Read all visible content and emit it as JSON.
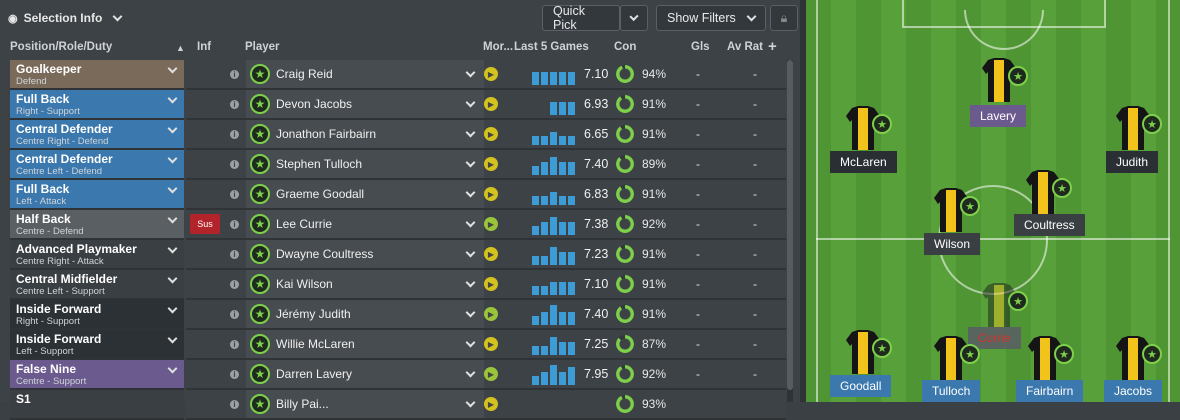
{
  "toolbar": {
    "selection_label": "Selection Info",
    "quick_pick": "Quick Pick",
    "show_filters": "Show Filters"
  },
  "headers": {
    "position": "Position/Role/Duty",
    "inf": "Inf",
    "player": "Player",
    "morale": "Mor...",
    "last5": "Last 5 Games",
    "con": "Con",
    "gls": "Gls",
    "avrat": "Av Rat"
  },
  "roles": [
    {
      "name": "Goalkeeper",
      "duty": "Defend",
      "color": "#7a6a5a"
    },
    {
      "name": "Full Back",
      "duty": "Right - Support",
      "color": "#3a78ad"
    },
    {
      "name": "Central Defender",
      "duty": "Centre Right - Defend",
      "color": "#3a78ad"
    },
    {
      "name": "Central Defender",
      "duty": "Centre Left - Defend",
      "color": "#3a78ad"
    },
    {
      "name": "Full Back",
      "duty": "Left - Attack",
      "color": "#3a78ad"
    },
    {
      "name": "Half Back",
      "duty": "Centre - Defend",
      "color": "#5a5f63"
    },
    {
      "name": "Advanced Playmaker",
      "duty": "Centre Right - Attack",
      "color": "#3a3f43"
    },
    {
      "name": "Central Midfielder",
      "duty": "Centre Left - Support",
      "color": "#3a3f43"
    },
    {
      "name": "Inside Forward",
      "duty": "Right - Support",
      "color": "#2c3135"
    },
    {
      "name": "Inside Forward",
      "duty": "Left - Support",
      "color": "#2c3135"
    },
    {
      "name": "False Nine",
      "duty": "Centre - Support",
      "color": "#6a5a8e"
    },
    {
      "name": "S1",
      "duty": "",
      "color": "#3a3f43"
    }
  ],
  "players": [
    {
      "name": "Craig Reid",
      "rating": "7.10",
      "con": "94%",
      "gls": "-",
      "avrat": "-",
      "morale": "#d4c21e",
      "form": [
        0.6,
        0.6,
        0.6,
        0.6,
        0.6
      ]
    },
    {
      "name": "Devon Jacobs",
      "rating": "6.93",
      "con": "91%",
      "gls": "-",
      "avrat": "-",
      "morale": "#d4c21e",
      "form": [
        0,
        0,
        0.6,
        0.6,
        0.6
      ]
    },
    {
      "name": "Jonathon Fairbairn",
      "rating": "6.65",
      "con": "91%",
      "gls": "-",
      "avrat": "-",
      "morale": "#d4c21e",
      "form": [
        0.4,
        0.4,
        0.6,
        0.4,
        0.4
      ]
    },
    {
      "name": "Stephen Tulloch",
      "rating": "7.40",
      "con": "89%",
      "gls": "-",
      "avrat": "-",
      "morale": "#d4c21e",
      "form": [
        0.4,
        0.6,
        0.8,
        0.6,
        0.6
      ]
    },
    {
      "name": "Graeme Goodall",
      "rating": "6.83",
      "con": "91%",
      "gls": "-",
      "avrat": "-",
      "morale": "#d4c21e",
      "form": [
        0.4,
        0.4,
        0.6,
        0.4,
        0.4
      ]
    },
    {
      "name": "Lee Currie",
      "rating": "7.38",
      "con": "92%",
      "gls": "-",
      "avrat": "-",
      "morale": "#9ac43a",
      "form": [
        0.4,
        0.6,
        0.8,
        0.6,
        0.6
      ],
      "status": "Sus"
    },
    {
      "name": "Dwayne Coultress",
      "rating": "7.23",
      "con": "91%",
      "gls": "-",
      "avrat": "-",
      "morale": "#d4c21e",
      "form": [
        0.4,
        0.4,
        0.8,
        0.6,
        0.6
      ]
    },
    {
      "name": "Kai Wilson",
      "rating": "7.10",
      "con": "91%",
      "gls": "-",
      "avrat": "-",
      "morale": "#d4c21e",
      "form": [
        0.4,
        0.4,
        0.6,
        0.6,
        0.6
      ]
    },
    {
      "name": "Jérémy Judith",
      "rating": "7.40",
      "con": "91%",
      "gls": "-",
      "avrat": "-",
      "morale": "#9ac43a",
      "form": [
        0.4,
        0.6,
        0.9,
        0.6,
        0.6
      ]
    },
    {
      "name": "Willie McLaren",
      "rating": "7.25",
      "con": "87%",
      "gls": "-",
      "avrat": "-",
      "morale": "#d4c21e",
      "form": [
        0.4,
        0.4,
        0.8,
        0.6,
        0.6
      ]
    },
    {
      "name": "Darren Lavery",
      "rating": "7.95",
      "con": "92%",
      "gls": "-",
      "avrat": "-",
      "morale": "#9ac43a",
      "form": [
        0.4,
        0.6,
        0.9,
        0.6,
        0.8
      ]
    },
    {
      "name": "Billy Pai...",
      "rating": "",
      "con": "93%",
      "gls": "",
      "avrat": "",
      "morale": "#d4c21e",
      "form": [
        0,
        0,
        0,
        0,
        0
      ]
    }
  ],
  "pitch": [
    {
      "name": "Lavery",
      "bg": "#6a5a8e",
      "kind": "label"
    },
    {
      "name": "McLaren",
      "bg": "#2a2f33",
      "kind": "label"
    },
    {
      "name": "Judith",
      "bg": "#2a2f33",
      "kind": "label"
    },
    {
      "name": "Coultress",
      "bg": "#3a3f43",
      "kind": "label"
    },
    {
      "name": "Wilson",
      "bg": "#3a3f43",
      "kind": "label"
    },
    {
      "name": "Currie",
      "bg": "#5a5f63",
      "kind": "label",
      "color": "#e02a2a"
    },
    {
      "name": "Goodall",
      "bg": "#3a78ad",
      "kind": "label"
    },
    {
      "name": "Tulloch",
      "bg": "#3a78ad",
      "kind": "label"
    },
    {
      "name": "Fairbairn",
      "bg": "#3a78ad",
      "kind": "label"
    },
    {
      "name": "Jacobs",
      "bg": "#3a78ad",
      "kind": "label"
    }
  ]
}
